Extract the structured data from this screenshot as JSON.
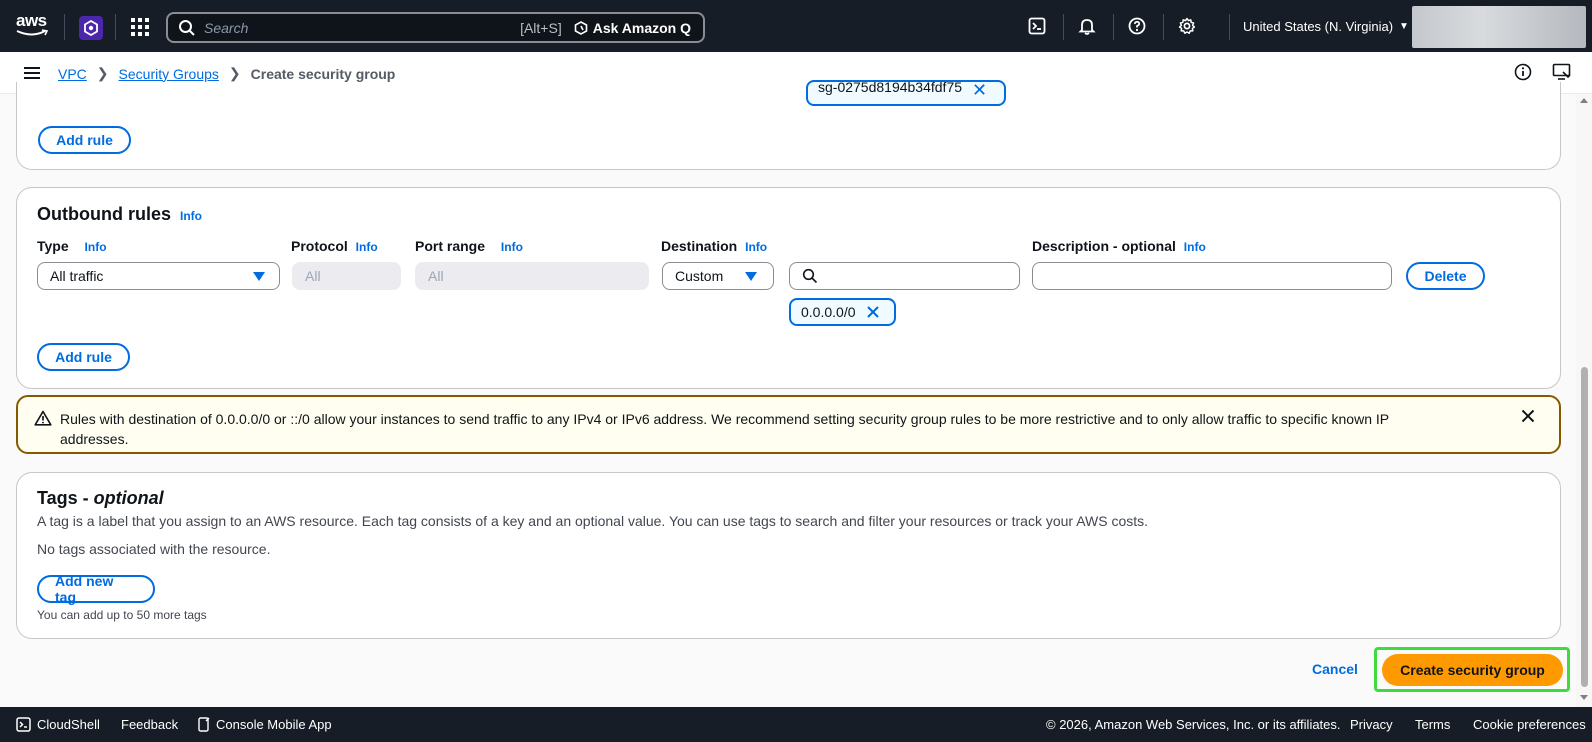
{
  "topnav": {
    "logo": "aws",
    "search_placeholder": "Search",
    "search_shortcut": "[Alt+S]",
    "ask_q": "Ask Amazon Q",
    "region": "United States (N. Virginia)"
  },
  "breadcrumb": {
    "items": [
      "VPC",
      "Security Groups"
    ],
    "current": "Create security group"
  },
  "inbound": {
    "token_partial": "sg-0275d8194b34fdf75",
    "add_rule": "Add rule"
  },
  "outbound": {
    "title": "Outbound rules",
    "info": "Info",
    "col_type": "Type",
    "col_protocol": "Protocol",
    "col_port": "Port range",
    "col_destination": "Destination",
    "col_description": "Description - optional",
    "type_value": "All traffic",
    "protocol_value": "All",
    "port_value": "All",
    "destination_value": "Custom",
    "dest_token": "0.0.0.0/0",
    "delete": "Delete",
    "add_rule": "Add rule"
  },
  "alert": {
    "text": "Rules with destination of 0.0.0.0/0 or ::/0 allow your instances to send traffic to any IPv4 or IPv6 address. We recommend setting security group rules to be more restrictive and to only allow traffic to specific known IP addresses."
  },
  "tags": {
    "title": "Tags - ",
    "title_optional": "optional",
    "description": "A tag is a label that you assign to an AWS resource. Each tag consists of a key and an optional value. You can use tags to search and filter your resources or track your AWS costs.",
    "empty": "No tags associated with the resource.",
    "add_tag": "Add new tag",
    "hint": "You can add up to 50 more tags"
  },
  "actions": {
    "cancel": "Cancel",
    "create": "Create security group"
  },
  "footer": {
    "cloudshell": "CloudShell",
    "feedback": "Feedback",
    "mobile": "Console Mobile App",
    "copyright": "© 2026, Amazon Web Services, Inc. or its affiliates.",
    "privacy": "Privacy",
    "terms": "Terms",
    "cookies": "Cookie preferences"
  },
  "colors": {
    "nav_bg": "#161d26",
    "link": "#006ce0",
    "primary": "#ff9900",
    "warning_border": "#855900"
  }
}
